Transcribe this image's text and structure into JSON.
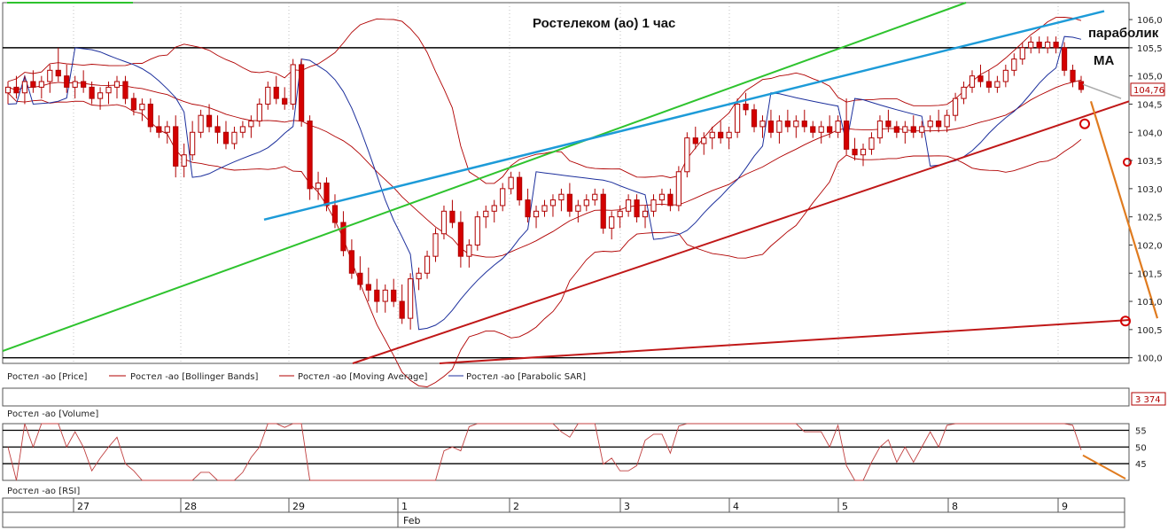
{
  "chart_data": {
    "type": "candlestick",
    "title": "Ростелеком (ао)    1 час",
    "annotations": {
      "parabolic": "параболик",
      "ma": "MA"
    },
    "price_axis": {
      "ylim": [
        99.9,
        106.3
      ],
      "ticks": [
        "106,0",
        "105,5",
        "105,0",
        "104,5",
        "104,0",
        "103,5",
        "103,0",
        "102,5",
        "102,0",
        "101,5",
        "101,0",
        "100,5",
        "100,0"
      ],
      "tick_values": [
        106.0,
        105.5,
        105.0,
        104.5,
        104.0,
        103.5,
        103.0,
        102.5,
        102.0,
        101.5,
        101.0,
        100.5,
        100.0
      ],
      "last_value": "104,76"
    },
    "legend": [
      {
        "name": "Ростел -ао [Price]",
        "color": "#b00000"
      },
      {
        "name": "Ростел -ао [Bollinger Bands]",
        "color": "#b00000"
      },
      {
        "name": "Ростел -ао [Moving Average]",
        "color": "#b00000"
      },
      {
        "name": "Ростел -ао [Parabolic SAR]",
        "color": "#1c2f9c"
      }
    ],
    "volume_panel": {
      "label": "Ростел -ао [Volume]",
      "last_value": "3 374"
    },
    "rsi_panel": {
      "label": "Ростел -ао [RSI]",
      "ticks": [
        "55",
        "50",
        "45"
      ],
      "tick_values": [
        55,
        50,
        45
      ],
      "ylim": [
        40,
        57
      ]
    },
    "dates": [
      "27",
      "28",
      "29",
      "1",
      "2",
      "3",
      "4",
      "5",
      "8",
      "9"
    ],
    "month_label": "Feb",
    "horizontal_levels": [
      100.0,
      105.5
    ],
    "candles": [
      [
        104.7,
        104.9,
        104.5,
        104.8
      ],
      [
        104.8,
        105.0,
        104.6,
        104.7
      ],
      [
        104.7,
        105.0,
        104.5,
        104.9
      ],
      [
        104.9,
        105.1,
        104.7,
        104.8
      ],
      [
        104.8,
        105.0,
        104.6,
        104.9
      ],
      [
        104.9,
        105.2,
        104.7,
        105.1
      ],
      [
        105.1,
        105.5,
        104.9,
        105.0
      ],
      [
        105.0,
        105.2,
        104.7,
        104.8
      ],
      [
        104.8,
        105.0,
        104.6,
        104.9
      ],
      [
        104.9,
        105.1,
        104.7,
        104.8
      ],
      [
        104.8,
        104.9,
        104.5,
        104.6
      ],
      [
        104.6,
        104.8,
        104.4,
        104.7
      ],
      [
        104.7,
        104.9,
        104.5,
        104.8
      ],
      [
        104.8,
        105.0,
        104.6,
        104.9
      ],
      [
        104.9,
        105.0,
        104.5,
        104.6
      ],
      [
        104.6,
        104.7,
        104.3,
        104.4
      ],
      [
        104.4,
        104.6,
        104.2,
        104.5
      ],
      [
        104.5,
        104.6,
        104.0,
        104.1
      ],
      [
        104.1,
        104.3,
        103.9,
        104.0
      ],
      [
        104.0,
        104.2,
        103.8,
        104.1
      ],
      [
        104.1,
        104.3,
        103.2,
        103.4
      ],
      [
        103.4,
        103.8,
        103.2,
        103.6
      ],
      [
        103.6,
        104.2,
        103.5,
        104.0
      ],
      [
        104.0,
        104.4,
        103.9,
        104.3
      ],
      [
        104.3,
        104.5,
        104.0,
        104.1
      ],
      [
        104.1,
        104.3,
        103.8,
        104.0
      ],
      [
        104.0,
        104.2,
        103.7,
        103.8
      ],
      [
        103.8,
        104.1,
        103.7,
        104.0
      ],
      [
        104.0,
        104.2,
        103.9,
        104.1
      ],
      [
        104.1,
        104.3,
        103.9,
        104.2
      ],
      [
        104.2,
        104.6,
        104.1,
        104.5
      ],
      [
        104.5,
        104.9,
        104.4,
        104.8
      ],
      [
        104.8,
        105.0,
        104.5,
        104.6
      ],
      [
        104.6,
        104.8,
        104.4,
        104.5
      ],
      [
        104.5,
        105.3,
        104.4,
        105.2
      ],
      [
        105.2,
        105.3,
        104.1,
        104.2
      ],
      [
        104.2,
        104.3,
        102.8,
        103.0
      ],
      [
        103.0,
        103.3,
        102.8,
        103.1
      ],
      [
        103.1,
        103.2,
        102.6,
        102.7
      ],
      [
        102.7,
        102.9,
        102.3,
        102.4
      ],
      [
        102.4,
        102.6,
        101.8,
        101.9
      ],
      [
        101.9,
        102.1,
        101.4,
        101.5
      ],
      [
        101.5,
        101.8,
        101.2,
        101.3
      ],
      [
        101.3,
        101.6,
        101.0,
        101.2
      ],
      [
        101.2,
        101.4,
        100.8,
        101.0
      ],
      [
        101.0,
        101.3,
        100.8,
        101.2
      ],
      [
        101.2,
        101.4,
        100.9,
        101.0
      ],
      [
        101.0,
        101.3,
        100.6,
        100.7
      ],
      [
        100.7,
        101.5,
        100.5,
        101.4
      ],
      [
        101.4,
        101.6,
        101.2,
        101.5
      ],
      [
        101.5,
        101.9,
        101.4,
        101.8
      ],
      [
        101.8,
        102.3,
        101.7,
        102.2
      ],
      [
        102.2,
        102.7,
        102.1,
        102.6
      ],
      [
        102.6,
        102.8,
        102.3,
        102.4
      ],
      [
        102.4,
        102.6,
        101.6,
        101.8
      ],
      [
        101.8,
        102.1,
        101.6,
        102.0
      ],
      [
        102.0,
        102.6,
        101.9,
        102.5
      ],
      [
        102.5,
        102.7,
        102.3,
        102.6
      ],
      [
        102.6,
        102.8,
        102.4,
        102.7
      ],
      [
        102.7,
        103.1,
        102.6,
        103.0
      ],
      [
        103.0,
        103.3,
        102.9,
        103.2
      ],
      [
        103.2,
        103.3,
        102.7,
        102.8
      ],
      [
        102.8,
        103.0,
        102.4,
        102.5
      ],
      [
        102.5,
        102.7,
        102.3,
        102.6
      ],
      [
        102.6,
        102.8,
        102.5,
        102.7
      ],
      [
        102.7,
        102.9,
        102.5,
        102.8
      ],
      [
        102.8,
        103.0,
        102.6,
        102.9
      ],
      [
        102.9,
        103.1,
        102.5,
        102.6
      ],
      [
        102.6,
        102.8,
        102.4,
        102.7
      ],
      [
        102.7,
        102.9,
        102.6,
        102.8
      ],
      [
        102.8,
        103.0,
        102.7,
        102.9
      ],
      [
        102.9,
        103.0,
        102.2,
        102.3
      ],
      [
        102.3,
        102.6,
        102.1,
        102.5
      ],
      [
        102.5,
        102.7,
        102.3,
        102.6
      ],
      [
        102.6,
        102.9,
        102.5,
        102.8
      ],
      [
        102.8,
        102.9,
        102.4,
        102.5
      ],
      [
        102.5,
        102.7,
        102.3,
        102.6
      ],
      [
        102.6,
        102.9,
        102.5,
        102.8
      ],
      [
        102.8,
        103.0,
        102.7,
        102.9
      ],
      [
        102.9,
        103.0,
        102.6,
        102.7
      ],
      [
        102.7,
        103.4,
        102.6,
        103.3
      ],
      [
        103.3,
        104.0,
        103.2,
        103.9
      ],
      [
        103.9,
        104.1,
        103.7,
        103.8
      ],
      [
        103.8,
        104.0,
        103.6,
        103.9
      ],
      [
        103.9,
        104.1,
        103.7,
        104.0
      ],
      [
        104.0,
        104.2,
        103.8,
        103.9
      ],
      [
        103.9,
        104.1,
        103.7,
        104.0
      ],
      [
        104.0,
        104.6,
        103.9,
        104.5
      ],
      [
        104.5,
        104.7,
        104.3,
        104.4
      ],
      [
        104.4,
        104.5,
        104.0,
        104.1
      ],
      [
        104.1,
        104.3,
        103.9,
        104.2
      ],
      [
        104.2,
        104.4,
        103.9,
        104.0
      ],
      [
        104.0,
        104.3,
        103.8,
        104.2
      ],
      [
        104.2,
        104.4,
        104.0,
        104.1
      ],
      [
        104.1,
        104.3,
        103.9,
        104.2
      ],
      [
        104.2,
        104.4,
        104.0,
        104.1
      ],
      [
        104.1,
        104.2,
        103.9,
        104.0
      ],
      [
        104.0,
        104.2,
        103.8,
        104.1
      ],
      [
        104.1,
        104.3,
        103.9,
        104.0
      ],
      [
        104.0,
        104.3,
        103.9,
        104.2
      ],
      [
        104.2,
        104.6,
        103.6,
        103.7
      ],
      [
        103.7,
        103.9,
        103.5,
        103.6
      ],
      [
        103.6,
        103.8,
        103.4,
        103.7
      ],
      [
        103.7,
        104.0,
        103.6,
        103.9
      ],
      [
        103.9,
        104.3,
        103.8,
        104.2
      ],
      [
        104.2,
        104.4,
        104.0,
        104.1
      ],
      [
        104.1,
        104.2,
        103.9,
        104.0
      ],
      [
        104.0,
        104.2,
        103.8,
        104.1
      ],
      [
        104.1,
        104.3,
        103.9,
        104.0
      ],
      [
        104.0,
        104.2,
        103.9,
        104.1
      ],
      [
        104.1,
        104.3,
        104.0,
        104.2
      ],
      [
        104.2,
        104.4,
        104.0,
        104.1
      ],
      [
        104.1,
        104.4,
        104.0,
        104.3
      ],
      [
        104.3,
        104.7,
        104.2,
        104.6
      ],
      [
        104.6,
        104.9,
        104.5,
        104.8
      ],
      [
        104.8,
        105.1,
        104.7,
        105.0
      ],
      [
        105.0,
        105.2,
        104.8,
        104.9
      ],
      [
        104.9,
        105.1,
        104.7,
        104.8
      ],
      [
        104.8,
        105.0,
        104.7,
        104.9
      ],
      [
        104.9,
        105.2,
        104.8,
        105.1
      ],
      [
        105.1,
        105.4,
        105.0,
        105.3
      ],
      [
        105.3,
        105.6,
        105.2,
        105.5
      ],
      [
        105.5,
        105.7,
        105.4,
        105.6
      ],
      [
        105.6,
        105.7,
        105.4,
        105.5
      ],
      [
        105.5,
        105.7,
        105.4,
        105.6
      ],
      [
        105.6,
        105.7,
        105.4,
        105.5
      ],
      [
        105.5,
        105.6,
        105.0,
        105.1
      ],
      [
        105.1,
        105.2,
        104.8,
        104.9
      ],
      [
        104.9,
        105.0,
        104.7,
        104.76
      ]
    ]
  }
}
